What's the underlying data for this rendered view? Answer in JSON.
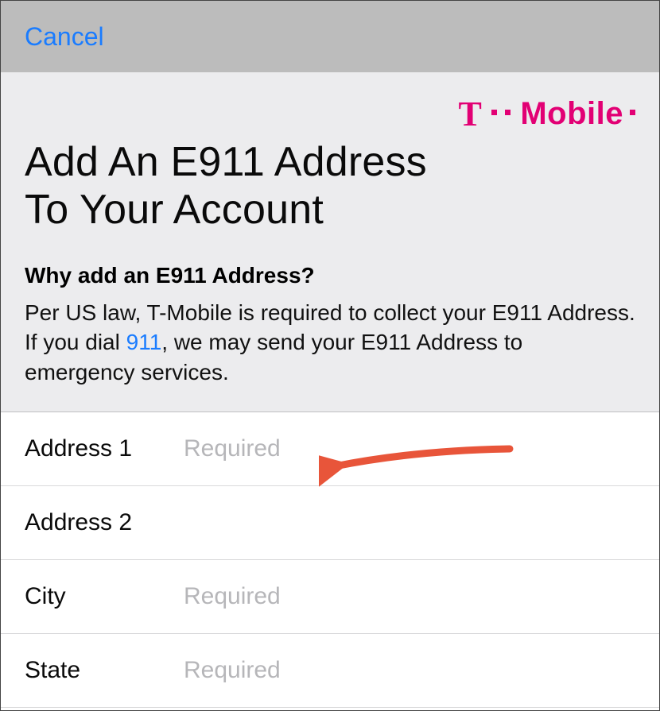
{
  "navbar": {
    "cancel_label": "Cancel"
  },
  "brand": {
    "letter": "T",
    "word": "Mobile"
  },
  "heading": {
    "line1": "Add An E911 Address",
    "line2": "To Your Account"
  },
  "info": {
    "subheading": "Why add an E911 Address?",
    "desc_part1": "Per US law, T-Mobile is required to collect your E911 Address. If you dial ",
    "link_text": "911",
    "desc_part2": ", we may send your E911 Address to emergency services."
  },
  "form": {
    "rows": [
      {
        "label": "Address 1",
        "placeholder": "Required",
        "value": ""
      },
      {
        "label": "Address 2",
        "placeholder": "",
        "value": ""
      },
      {
        "label": "City",
        "placeholder": "Required",
        "value": ""
      },
      {
        "label": "State",
        "placeholder": "Required",
        "value": ""
      }
    ]
  }
}
